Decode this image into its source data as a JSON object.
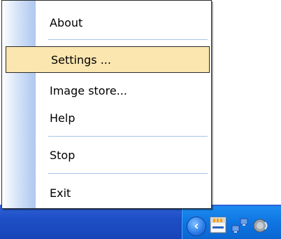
{
  "menu": {
    "items": [
      {
        "label": "About"
      },
      {
        "label": "Settings ..."
      },
      {
        "label": "Image store..."
      },
      {
        "label": "Help"
      },
      {
        "label": "Stop"
      },
      {
        "label": "Exit"
      }
    ]
  },
  "tray": {
    "icons": [
      "show-hidden-icons-chevron",
      "app-tray-icon",
      "network-icon",
      "volume-icon"
    ]
  }
}
